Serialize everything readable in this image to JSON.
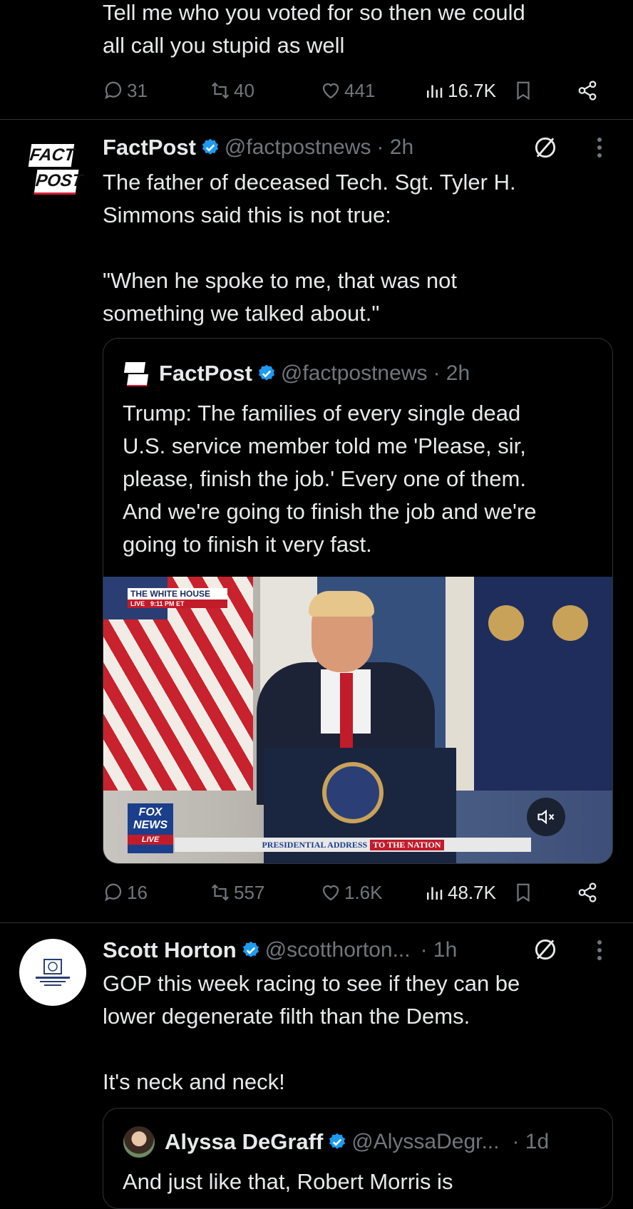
{
  "tweet0": {
    "text": "Tell me who you voted for so then we could\nall call you stupid as well",
    "replies": "31",
    "retweets": "40",
    "likes": "441",
    "views": "16.7K"
  },
  "tweet1": {
    "avatar_text_1": "FACT",
    "avatar_text_2": "POST",
    "name": "FactPost",
    "handle": "@factpostnews",
    "time": "· 2h",
    "text": "The father of deceased Tech. Sgt. Tyler H.\nSimmons said this is not true:\n\n\"When he spoke to me, that was not\nsomething we talked about.\"",
    "quote": {
      "name": "FactPost",
      "handle": "@factpostnews",
      "time": "· 2h",
      "text": "Trump: The families of every single dead\nU.S. service member told me 'Please, sir,\nplease, finish the job.' Every one of them.\nAnd we're going to finish the job and we're\ngoing to finish it very fast.",
      "video": {
        "bug_title": "THE WHITE HOUSE",
        "bug_live": "LIVE",
        "bug_time": "9:11 PM ET",
        "network_1": "FOX",
        "network_2": "NEWS",
        "network_live": "LIVE",
        "ticker_left": "PRESIDENTIAL ADDRESS",
        "ticker_right": "TO THE NATION"
      }
    },
    "replies": "16",
    "retweets": "557",
    "likes": "1.6K",
    "views": "48.7K"
  },
  "tweet2": {
    "name": "Scott Horton",
    "handle": "@scotthorton...",
    "time": "· 1h",
    "text": "GOP this week racing to see if they can be\nlower degenerate filth than the Dems.\n\nIt's neck and neck!",
    "quote": {
      "name": "Alyssa DeGraff",
      "handle": "@AlyssaDegr...",
      "time": "· 1d",
      "text": "And just like that, Robert Morris is"
    }
  },
  "colors": {
    "accent": "#1d9bf0",
    "muted": "#71767b",
    "divider": "#2f3336",
    "background": "#000000"
  }
}
